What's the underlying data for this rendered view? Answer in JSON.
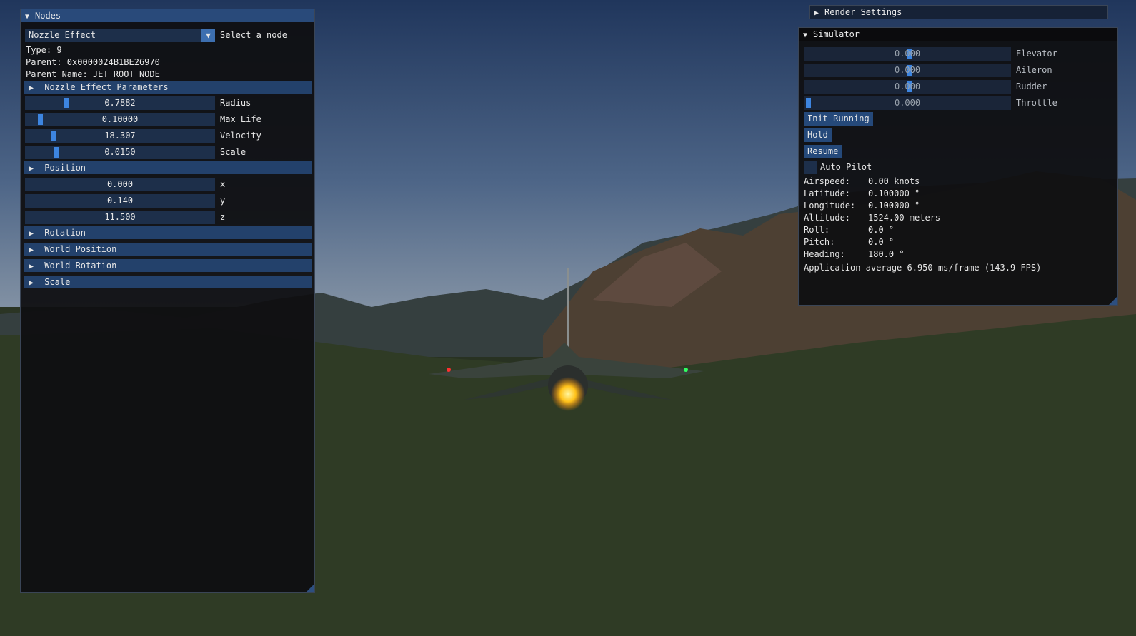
{
  "nodes_panel": {
    "title": "Nodes",
    "selected_node": "Nozzle Effect",
    "select_label": "Select a node",
    "type_line": "Type: 9",
    "parent_line": "Parent: 0x0000024B1BE26970",
    "parent_name_line": "Parent Name: JET_ROOT_NODE",
    "sections": {
      "params": "Nozzle Effect Parameters",
      "position": "Position",
      "rotation": "Rotation",
      "world_position": "World Position",
      "world_rotation": "World Rotation",
      "scale": "Scale"
    },
    "params": [
      {
        "value": "0.7882",
        "label": "Radius",
        "fraction": 0.21
      },
      {
        "value": "0.10000",
        "label": "Max Life",
        "fraction": 0.07
      },
      {
        "value": "18.307",
        "label": "Velocity",
        "fraction": 0.14
      },
      {
        "value": "0.0150",
        "label": "Scale",
        "fraction": 0.16
      }
    ],
    "position": [
      {
        "value": "0.000",
        "label": "x"
      },
      {
        "value": "0.140",
        "label": "y"
      },
      {
        "value": "11.500",
        "label": "z"
      }
    ]
  },
  "render_panel": {
    "title": "Render Settings"
  },
  "simulator_panel": {
    "title": "Simulator",
    "controls": [
      {
        "value": "0.000",
        "label": "Elevator",
        "fraction": 0.5
      },
      {
        "value": "0.000",
        "label": "Aileron",
        "fraction": 0.5
      },
      {
        "value": "0.000",
        "label": "Rudder",
        "fraction": 0.5
      },
      {
        "value": "0.000",
        "label": "Throttle",
        "fraction": 0.0
      }
    ],
    "buttons": {
      "init": "Init Running",
      "hold": "Hold",
      "resume": "Resume"
    },
    "autopilot_label": "Auto Pilot",
    "autopilot_checked": false,
    "telemetry": [
      {
        "key": "Airspeed:",
        "value": "0.00 knots"
      },
      {
        "key": "Latitude:",
        "value": "0.100000 °"
      },
      {
        "key": "Longitude:",
        "value": "0.100000 °"
      },
      {
        "key": "Altitude:",
        "value": "1524.00 meters"
      },
      {
        "key": "Roll:",
        "value": "0.0 °"
      },
      {
        "key": "Pitch:",
        "value": "0.0 °"
      },
      {
        "key": "Heading:",
        "value": "180.0 °"
      }
    ],
    "fps_line": "Application average 6.950 ms/frame (143.9 FPS)"
  },
  "colors": {
    "panel_bg": "#0f0f11",
    "title_active": "#294a7a",
    "header_bg": "#23416b",
    "field_bg": "#1d2f4a",
    "grab": "#3d85e0",
    "sky_top": "#23385d",
    "sky_bottom": "#8494a8",
    "terrain": "#262f1f"
  },
  "icons": [
    "collapse-arrow-down",
    "expand-arrow-right",
    "combo-arrow-down",
    "resize-grip",
    "jet-aircraft",
    "afterburner-glow"
  ]
}
